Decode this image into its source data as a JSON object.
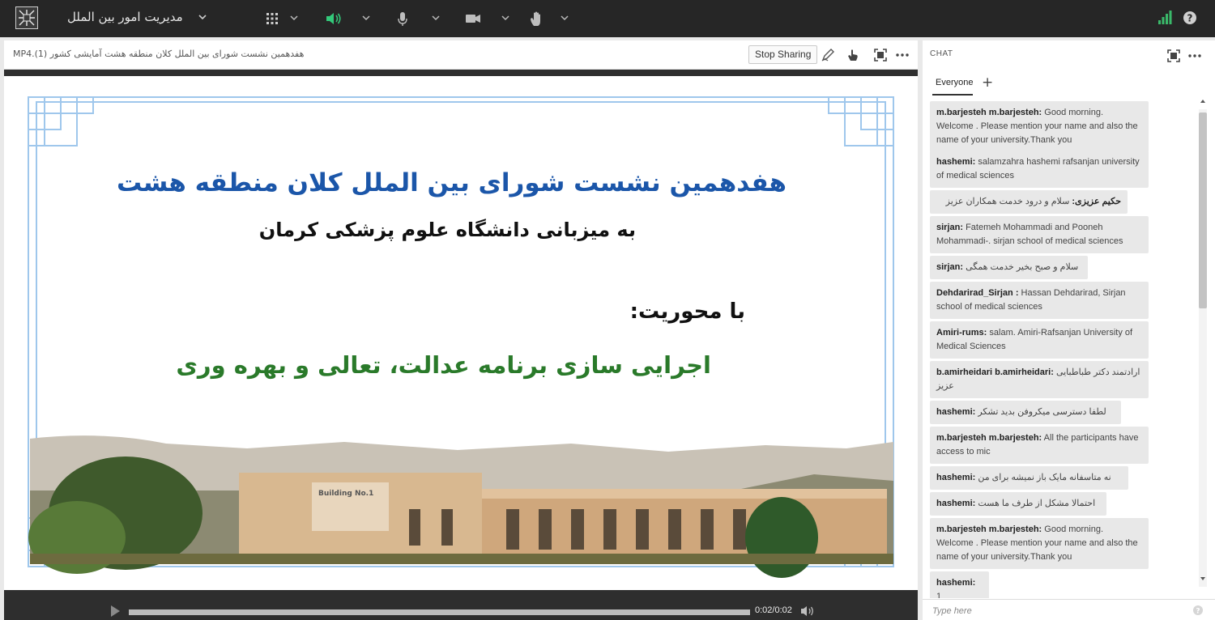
{
  "topbar": {
    "meeting_title": "مدیریت امور بین الملل",
    "icons": [
      "app-logo-icon",
      "chevron-down-icon",
      "grid-apps-icon",
      "speaker-icon",
      "microphone-icon",
      "camera-icon",
      "raise-hand-icon",
      "signal-bars-icon",
      "help-icon"
    ],
    "speaker_color": "#33c97a",
    "signal_color": "#3ab96a"
  },
  "share": {
    "filename": "هفدهمین نشست شورای بین الملل کلان منطقه هشت آمایشی کشور (1).MP4",
    "stop_label": "Stop Sharing",
    "slide": {
      "title": "هفدهمین نشست شورای بین الملل کلان منطقه هشت",
      "subtitle": "به میزبانی دانشگاه علوم پزشکی کرمان",
      "axis_label": "با محوریت:",
      "theme": "اجرایی سازی برنامه عدالت، تعالی و بهره وری",
      "building_sign": "Building No.1"
    },
    "player": {
      "time": "0:02/0:02",
      "progress": 1.0
    }
  },
  "chat": {
    "title": "CHAT",
    "tab": "Everyone",
    "add_label": "+",
    "input_placeholder": "Type here",
    "messages": [
      {
        "name": "m.barjesteh m.barjesteh:",
        "text": " Good morning. Welcome . Please mention your name and also the name of your university.Thank you",
        "dir": "ltr"
      },
      {
        "name": "hashemi:",
        "text": " salamzahra hashemi rafsanjan university of medical sciences",
        "dir": "ltr"
      },
      {
        "name": "حکیم عزیزی:",
        "text": " سلام و درود خدمت همکاران عزیز",
        "dir": "rtl"
      },
      {
        "name": "sirjan:",
        "text": " Fatemeh Mohammadi and Pooneh Mohammadi-. sirjan school of medical sciences",
        "dir": "ltr"
      },
      {
        "name": "sirjan:",
        "text": " سلام و صبح بخیر خدمت همگی",
        "dir": "ltr"
      },
      {
        "name": "Dehdarirad_Sirjan :",
        "text": " Hassan Dehdarirad, Sirjan school of medical sciences",
        "dir": "ltr"
      },
      {
        "name": "Amiri-rums:",
        "text": " salam. Amiri-Rafsanjan University of Medical Sciences",
        "dir": "ltr"
      },
      {
        "name": "b.amirheidari b.amirheidari:",
        "text": " ارادتمند دکتر طباطبایی عزیز",
        "dir": "ltr"
      },
      {
        "name": "hashemi:",
        "text": " لطفا دسترسی میکروفن  بدید تشکر",
        "dir": "ltr"
      },
      {
        "name": "m.barjesteh m.barjesteh:",
        "text": " All the participants have access to mic",
        "dir": "ltr"
      },
      {
        "name": "hashemi:",
        "text": " نه متاسفانه مایک باز نمیشه برای من",
        "dir": "ltr"
      },
      {
        "name": "hashemi:",
        "text": " احتمالا مشکل از طرف ما هست",
        "dir": "ltr"
      },
      {
        "name": "m.barjesteh m.barjesteh:",
        "text": " Good morning. Welcome . Please mention your name and also the name of your university.Thank you",
        "dir": "ltr"
      },
      {
        "name": "hashemi:",
        "text": " 1",
        "dir": "ltr"
      }
    ]
  }
}
